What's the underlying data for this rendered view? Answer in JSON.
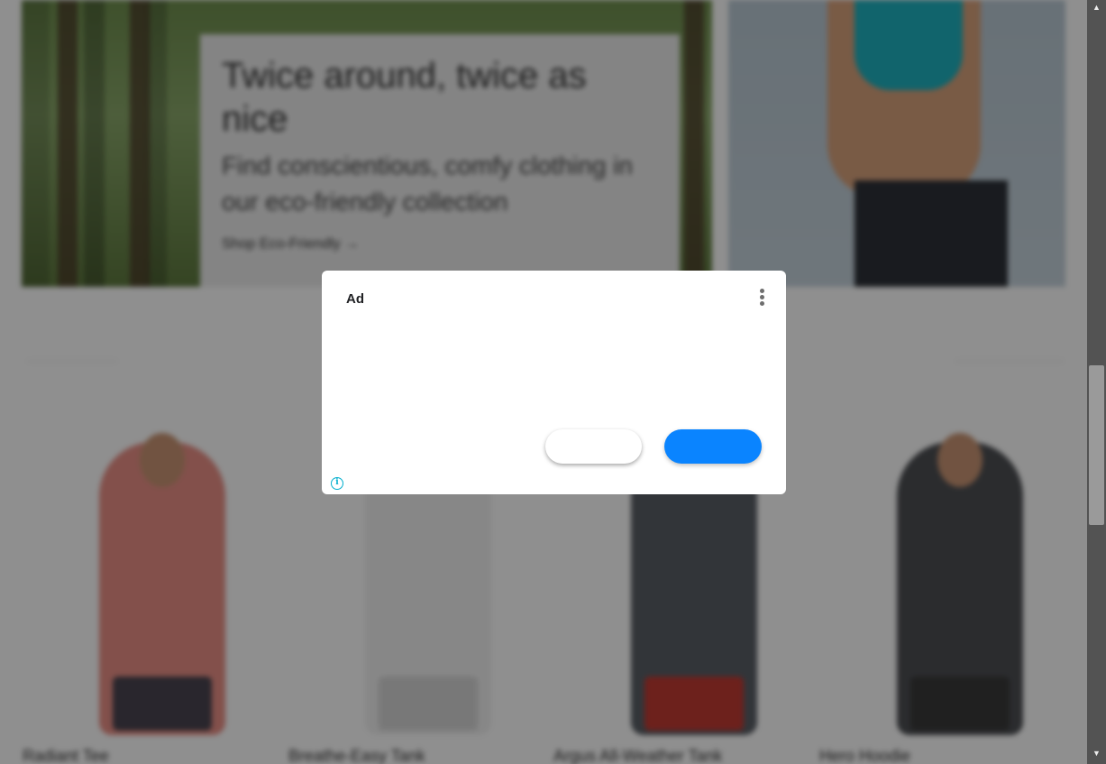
{
  "hero": {
    "title": "Twice around, twice as nice",
    "subtitle": "Find conscientious, comfy clothing in our eco-friendly collection",
    "link": "Shop Eco-Friendly →"
  },
  "products": [
    {
      "name": "Radiant Tee",
      "shirt_color": "#e98f86",
      "bottom_color": "#4a4550"
    },
    {
      "name": "Breathe-Easy Tank",
      "shirt_color": "#f1f1f1",
      "bottom_color": "#d7d7d7"
    },
    {
      "name": "Argus All-Weather Tank",
      "shirt_color": "#5a5f66",
      "bottom_color": "#c23b33"
    },
    {
      "name": "Hero Hoodie",
      "shirt_color": "#4d4f53",
      "bottom_color": "#3a3a3a"
    }
  ],
  "ad_dialog": {
    "label": "Ad",
    "menu_icon": "more-vertical-icon",
    "secondary_button_label": "",
    "primary_button_label": "",
    "info_icon": "info-icon",
    "info_glyph": "i"
  },
  "scrollbar": {
    "up_glyph": "▲",
    "down_glyph": "▼"
  }
}
